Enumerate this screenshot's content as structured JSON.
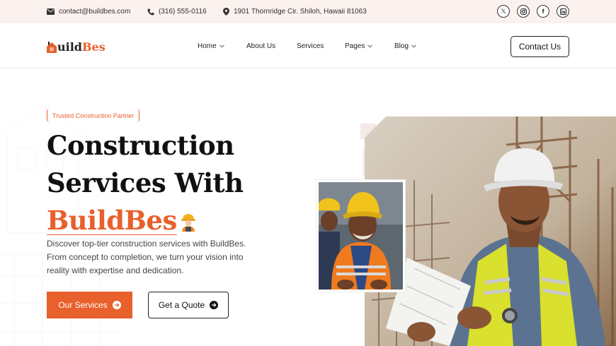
{
  "topbar": {
    "email": "contact@buildbes.com",
    "phone": "(316) 555-0116",
    "address": "1901 Thornridge Cir. Shiloh, Hawaii 81063",
    "socials": [
      "x-icon",
      "instagram-icon",
      "facebook-icon",
      "linkedin-icon"
    ]
  },
  "header": {
    "logo_prefix": "uild",
    "logo_accent": "Bes",
    "nav": [
      {
        "label": "Home",
        "dropdown": true
      },
      {
        "label": "About Us",
        "dropdown": false
      },
      {
        "label": "Services",
        "dropdown": false
      },
      {
        "label": "Pages",
        "dropdown": true
      },
      {
        "label": "Blog",
        "dropdown": true
      }
    ],
    "contact_label": "Contact Us"
  },
  "hero": {
    "badge": "Trusted Construction Partner",
    "title_line1": "Construction",
    "title_line2": "Services With",
    "title_brand": "BuildBes",
    "description": "Discover top-tier construction services with BuildBes. From concept to completion, we turn your vision into reality with expertise and dedication.",
    "primary_button": "Our Services",
    "secondary_button": "Get a Quote"
  },
  "colors": {
    "accent": "#e8602c",
    "topbar_bg": "#fbf1ee",
    "text": "#111111"
  }
}
